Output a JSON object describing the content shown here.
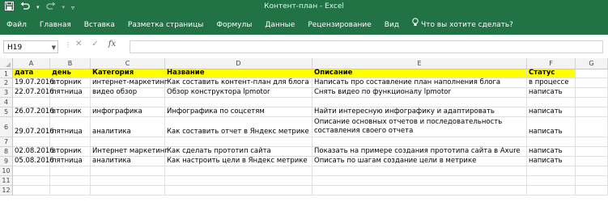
{
  "app": {
    "window_title": "Контент-план - Excel",
    "accent": "#217346",
    "qat": {
      "save_icon": "save-icon",
      "undo_icon": "undo-icon",
      "redo_icon": "redo-icon",
      "customize_icon": "chevron-down-icon"
    }
  },
  "ribbon": {
    "tabs": [
      "Файл",
      "Главная",
      "Вставка",
      "Разметка страницы",
      "Формулы",
      "Данные",
      "Рецензирование",
      "Вид"
    ],
    "tell_me": "Что вы хотите сделать?"
  },
  "formula_bar": {
    "name_box": "H19",
    "cancel_glyph": "✕",
    "enter_glyph": "✓",
    "fx_label": "fx",
    "formula": ""
  },
  "sheet": {
    "columns": [
      "A",
      "B",
      "C",
      "D",
      "E",
      "F",
      "G"
    ],
    "row_numbers": [
      "1",
      "2",
      "3",
      "4",
      "5",
      "6",
      "7",
      "8",
      "9",
      "10",
      "11",
      "12"
    ],
    "header_fill": "#ffff00",
    "header": [
      "дата",
      "день",
      "Категория",
      "Название",
      "Описание",
      "Статус",
      ""
    ],
    "rows": [
      [
        "19.07.2016",
        "вторник",
        "интернет-маркетинг",
        "Как составить контент-план для блога",
        "Написать про составление план наполнения блога",
        "в процессе",
        ""
      ],
      [
        "22.07.2016",
        "пятница",
        "видео обзор",
        "Обзор конструктора lpmotor",
        "Снять видео по функционалу lpmotor",
        "написать",
        ""
      ],
      [
        "",
        "",
        "",
        "",
        "",
        "",
        ""
      ],
      [
        "26.07.2016",
        "вторник",
        "инфографика",
        "Инфографика по соцсетям",
        "Найти интересную инфографику и адаптировать",
        "написать",
        ""
      ],
      [
        "29.07.2016",
        "пятница",
        "аналитика",
        "Как составить отчет в Яндекс метрике",
        "Описание основных отчетов и последовательность составления своего отчета",
        "написать",
        ""
      ],
      [
        "",
        "",
        "",
        "",
        "",
        "",
        ""
      ],
      [
        "02.08.2016",
        "вторник",
        "Интернет маркетинг",
        "Как сделать прототип сайта",
        "Показать на примере создания прототипа сайта в Axure",
        "написать",
        ""
      ],
      [
        "05.08.2016",
        "пятница",
        "аналитика",
        "Как настроить цели в Яндекс метрике",
        "Описать по шагам создание цели в метрике",
        "написать",
        ""
      ],
      [
        "",
        "",
        "",
        "",
        "",
        "",
        ""
      ],
      [
        "",
        "",
        "",
        "",
        "",
        "",
        ""
      ],
      [
        "",
        "",
        "",
        "",
        "",
        "",
        ""
      ]
    ]
  }
}
